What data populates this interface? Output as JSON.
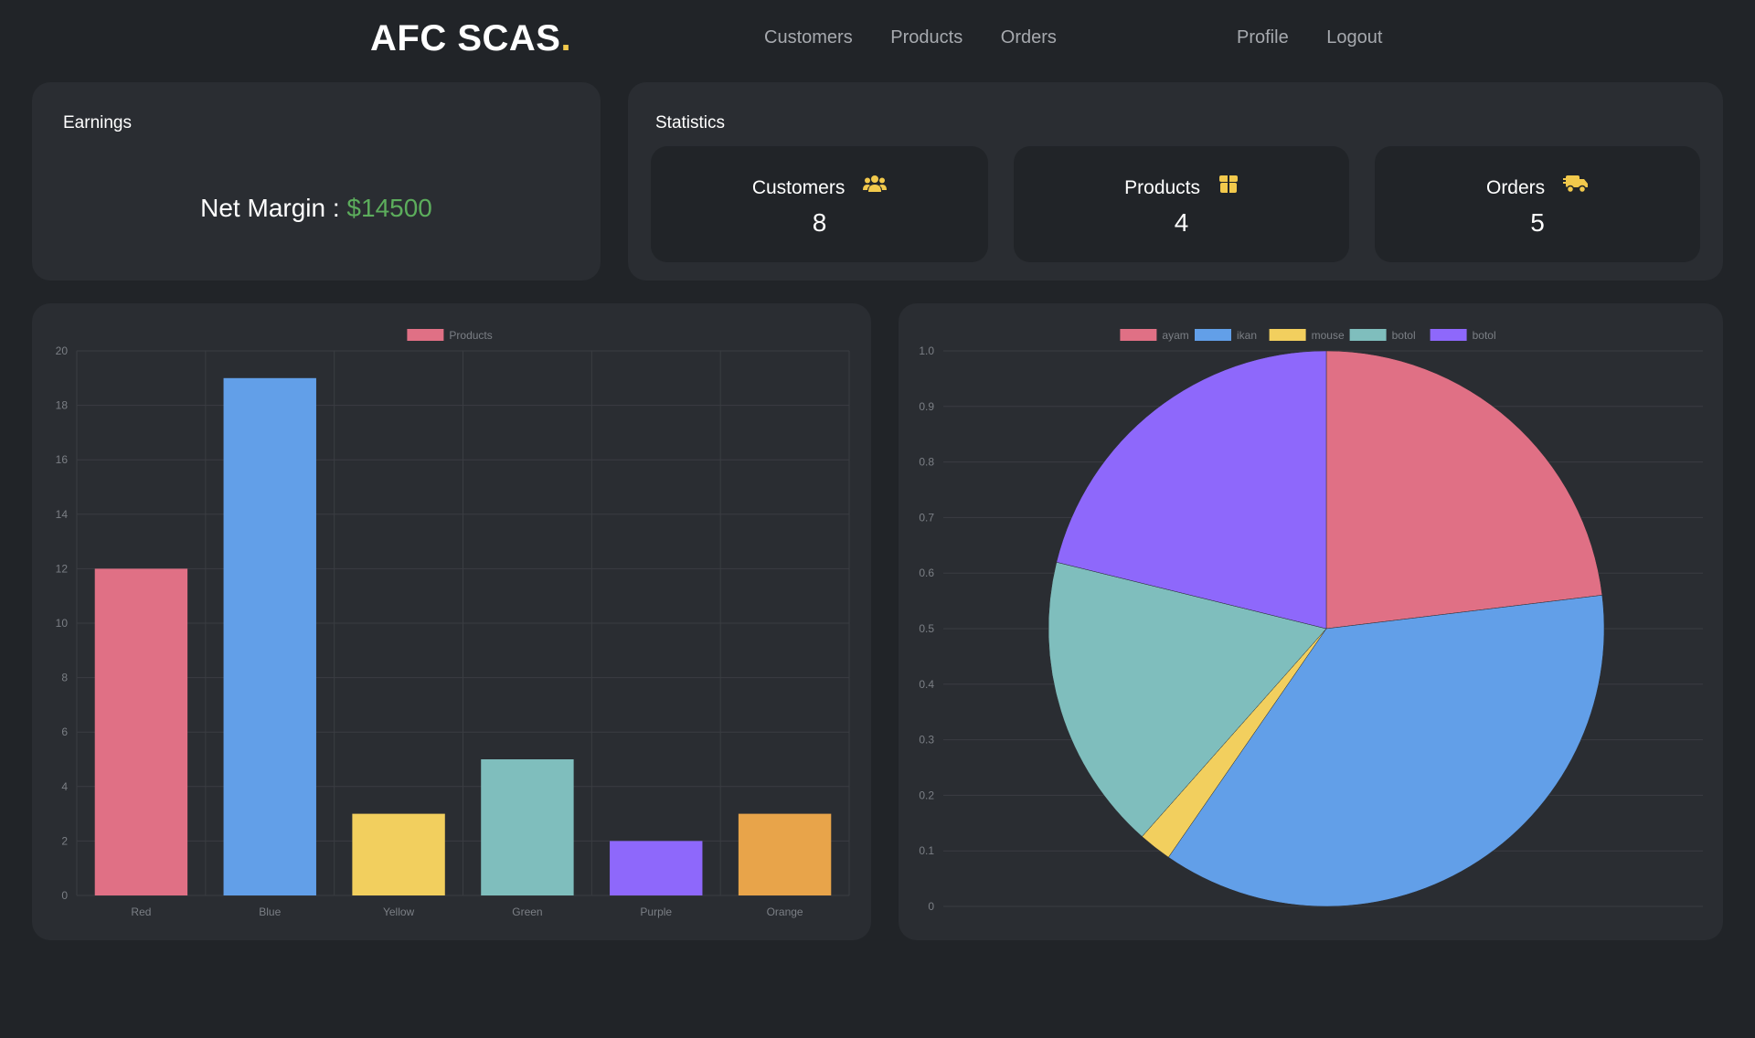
{
  "header": {
    "brand": "AFC SCAS",
    "brand_dot": ".",
    "nav_main": [
      "Customers",
      "Products",
      "Orders"
    ],
    "nav_right": [
      "Profile",
      "Logout"
    ]
  },
  "earnings": {
    "title": "Earnings",
    "label": "Net Margin : ",
    "value": "$14500"
  },
  "statistics": {
    "title": "Statistics",
    "items": [
      {
        "label": "Customers",
        "value": "8",
        "icon": "users-icon"
      },
      {
        "label": "Products",
        "value": "4",
        "icon": "box-icon"
      },
      {
        "label": "Orders",
        "value": "5",
        "icon": "truck-icon"
      }
    ],
    "icon_color": "#f2c94c"
  },
  "chart_data": [
    {
      "type": "bar",
      "legend": [
        "Products"
      ],
      "legend_position": "top-center",
      "categories": [
        "Red",
        "Blue",
        "Yellow",
        "Green",
        "Purple",
        "Orange"
      ],
      "series": [
        {
          "name": "Products",
          "values": [
            12,
            19,
            3,
            5,
            2,
            3
          ]
        }
      ],
      "colors": [
        "#e07085",
        "#629fe8",
        "#f2cf5e",
        "#7fbebd",
        "#8e68fb",
        "#e8a44a"
      ],
      "ylim": [
        0,
        20
      ],
      "yticks": [
        "0",
        "2",
        "4",
        "6",
        "8",
        "10",
        "12",
        "14",
        "16",
        "18",
        "20"
      ],
      "grid": true
    },
    {
      "type": "pie",
      "legend": [
        "ayam",
        "ikan",
        "mouse",
        "botol",
        "botol"
      ],
      "legend_position": "top-center",
      "values": [
        12,
        19,
        1,
        9,
        11
      ],
      "colors": [
        "#e07085",
        "#629fe8",
        "#f2cf5e",
        "#7fbebd",
        "#8e68fb"
      ],
      "yticks": [
        "0",
        "0.1",
        "0.2",
        "0.3",
        "0.4",
        "0.5",
        "0.6",
        "0.7",
        "0.8",
        "0.9",
        "1.0"
      ],
      "grid": true
    }
  ]
}
